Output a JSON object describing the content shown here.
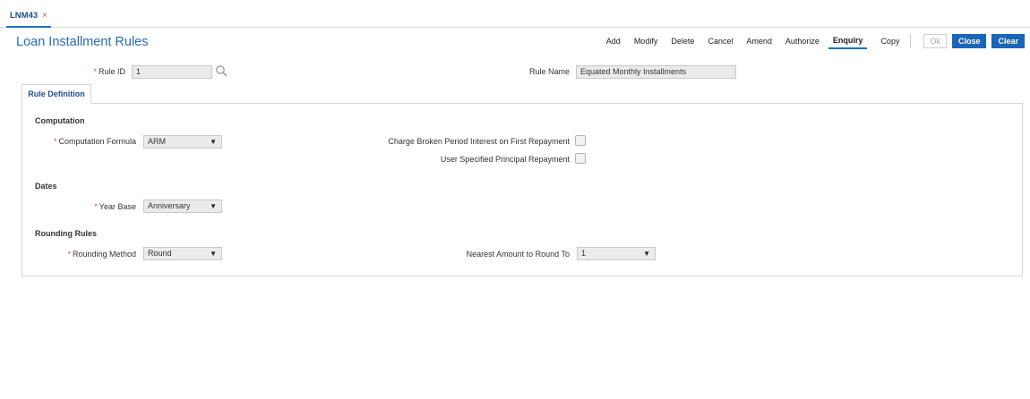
{
  "tabs": [
    {
      "label": "LNM43",
      "close": "×"
    }
  ],
  "page": {
    "title": "Loan Installment Rules"
  },
  "toolbar": {
    "buttons": [
      "Add",
      "Modify",
      "Delete",
      "Cancel",
      "Amend",
      "Authorize",
      "Enquiry",
      "Copy"
    ],
    "active": "Enquiry",
    "ok": "Ok",
    "close": "Close",
    "clear": "Clear"
  },
  "header_fields": {
    "rule_id": {
      "label": "Rule ID",
      "value": "1",
      "required": true
    },
    "rule_name": {
      "label": "Rule Name",
      "value": "Equated Monthly Installments"
    }
  },
  "subtab": {
    "label": "Rule Definition"
  },
  "computation": {
    "title": "Computation",
    "formula": {
      "label": "Computation Formula",
      "value": "ARM",
      "required": true
    },
    "charge_broken": {
      "label": "Charge Broken Period Interest on First Repayment",
      "checked": false
    },
    "user_principal": {
      "label": "User Specified Principal Repayment",
      "checked": false
    }
  },
  "dates": {
    "title": "Dates",
    "year_base": {
      "label": "Year Base",
      "value": "Anniversary",
      "required": true
    }
  },
  "rounding": {
    "title": "Rounding Rules",
    "method": {
      "label": "Rounding Method",
      "value": "Round",
      "required": true
    },
    "nearest": {
      "label": "Nearest Amount to Round To",
      "value": "1"
    }
  },
  "icons": {
    "search": "search-icon",
    "dropdown": "chevron-down-icon",
    "close": "close-icon"
  },
  "colors": {
    "accent": "#1b66b8",
    "title": "#2a6ab5",
    "required": "#d9534f"
  }
}
